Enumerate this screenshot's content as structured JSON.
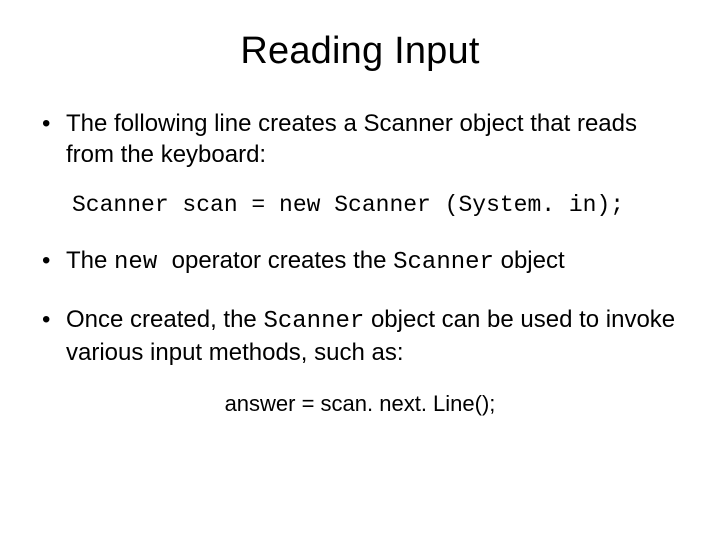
{
  "title": "Reading Input",
  "bullet1_pre": "The following line creates a Scanner object that reads from the keyboard:",
  "code1": "Scanner scan = new Scanner (System. in);",
  "bullet2_a": "The ",
  "bullet2_b_code": "new ",
  "bullet2_c": "operator creates the ",
  "bullet2_d_code": "Scanner",
  "bullet2_e": " object",
  "bullet3_a": "Once created, the ",
  "bullet3_b_code": "Scanner",
  "bullet3_c": " object can be used to invoke various input methods, such as:",
  "code2": "answer = scan. next. Line();"
}
